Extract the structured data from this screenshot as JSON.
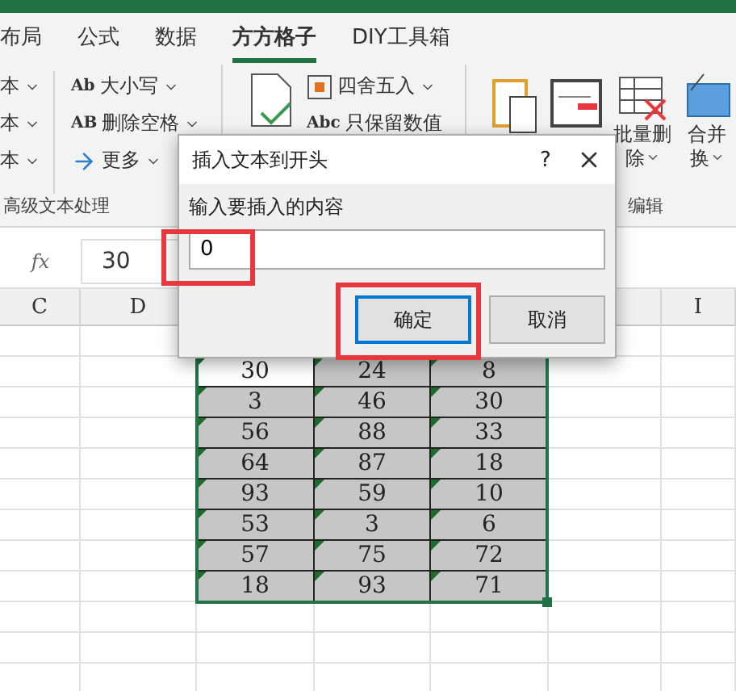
{
  "tabs": [
    {
      "label": "布局",
      "selected": false
    },
    {
      "label": "公式",
      "selected": false
    },
    {
      "label": "数据",
      "selected": false
    },
    {
      "label": "方方格子",
      "selected": true
    },
    {
      "label": "DIY工具箱",
      "selected": false
    }
  ],
  "ribbon": {
    "cut_items": [
      "本",
      "本",
      "本"
    ],
    "text_tools": [
      {
        "kind": "case",
        "glyph": "Ab",
        "label": "大小写"
      },
      {
        "kind": "trim",
        "glyph": "AB",
        "label": "删除空格"
      },
      {
        "kind": "more",
        "label": "更多"
      }
    ],
    "text_group_label": "高级文本处理",
    "number_tools": [
      {
        "kind": "round",
        "label": "四舍五入"
      },
      {
        "kind": "numeric",
        "glyph": "Abc",
        "label": "只保留数值"
      }
    ],
    "edit_tools": [
      {
        "kind": "paste"
      },
      {
        "kind": "insert"
      },
      {
        "kind": "delete",
        "lines": [
          "批量删",
          "除"
        ]
      },
      {
        "kind": "merge",
        "lines": [
          "合并",
          "换"
        ]
      }
    ],
    "edit_group_label": "编辑"
  },
  "formula_bar": {
    "fx": "fx",
    "value": "30"
  },
  "columns": [
    "C",
    "D",
    "I"
  ],
  "rows": [
    [
      {
        "text": "30",
        "active": true
      },
      {
        "text": "24",
        "active": false
      },
      {
        "text": "8",
        "active": false
      }
    ],
    [
      {
        "text": "3",
        "active": false
      },
      {
        "text": "46",
        "active": false
      },
      {
        "text": "30",
        "active": false
      }
    ],
    [
      {
        "text": "56",
        "active": false
      },
      {
        "text": "88",
        "active": false
      },
      {
        "text": "33",
        "active": false
      }
    ],
    [
      {
        "text": "64",
        "active": false
      },
      {
        "text": "87",
        "active": false
      },
      {
        "text": "18",
        "active": false
      }
    ],
    [
      {
        "text": "93",
        "active": false
      },
      {
        "text": "59",
        "active": false
      },
      {
        "text": "10",
        "active": false
      }
    ],
    [
      {
        "text": "53",
        "active": false
      },
      {
        "text": "3",
        "active": false
      },
      {
        "text": "6",
        "active": false
      }
    ],
    [
      {
        "text": "57",
        "active": false
      },
      {
        "text": "75",
        "active": false
      },
      {
        "text": "72",
        "active": false
      }
    ],
    [
      {
        "text": "18",
        "active": false
      },
      {
        "text": "93",
        "active": false
      },
      {
        "text": "71",
        "active": false
      }
    ]
  ],
  "dialog": {
    "title": "插入文本到开头",
    "help": "?",
    "label": "输入要插入的内容",
    "input": {
      "value": "0",
      "highlighted": true
    },
    "buttons": [
      {
        "label": "确定",
        "default": true,
        "highlighted": true
      },
      {
        "label": "取消",
        "default": false,
        "highlighted": false
      }
    ]
  }
}
